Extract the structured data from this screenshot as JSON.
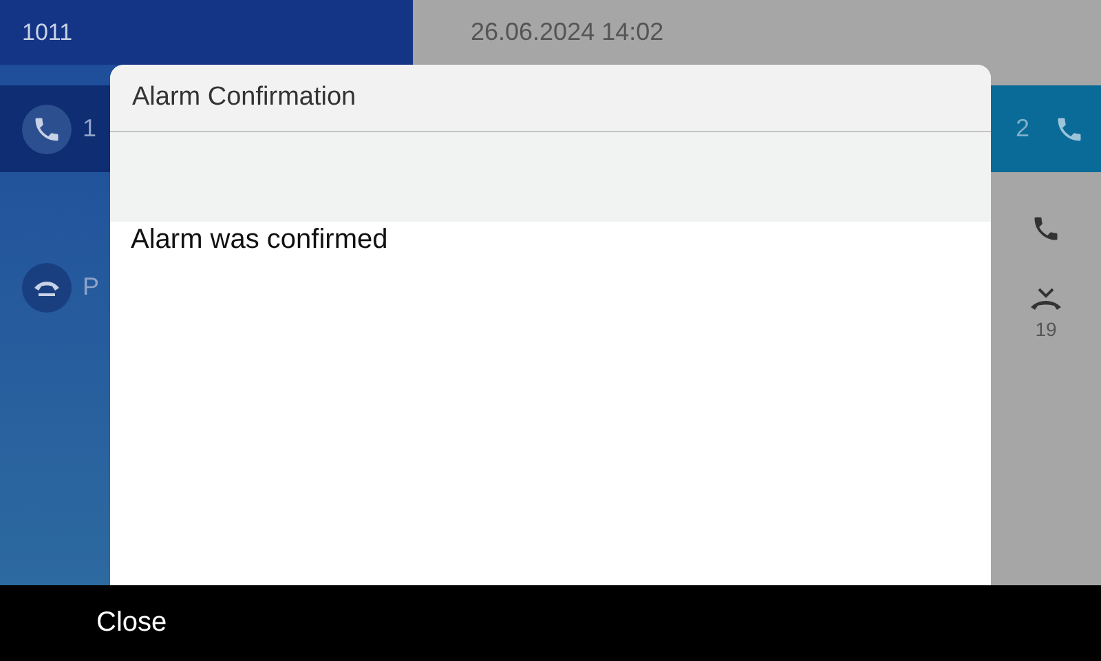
{
  "background": {
    "extension": "1011",
    "datetime": "26.06.2024 14:02",
    "left_lines": [
      {
        "kind": "active_call",
        "label": "1",
        "selected": true
      },
      {
        "kind": "parked",
        "label": "P",
        "selected": false
      }
    ],
    "right_line": {
      "label": "2"
    },
    "right_icons": [
      {
        "kind": "call"
      },
      {
        "kind": "missed",
        "count": "19"
      }
    ]
  },
  "dialog": {
    "title": "Alarm Confirmation",
    "message": "Alarm was confirmed"
  },
  "softkeys": [
    "Close"
  ]
}
